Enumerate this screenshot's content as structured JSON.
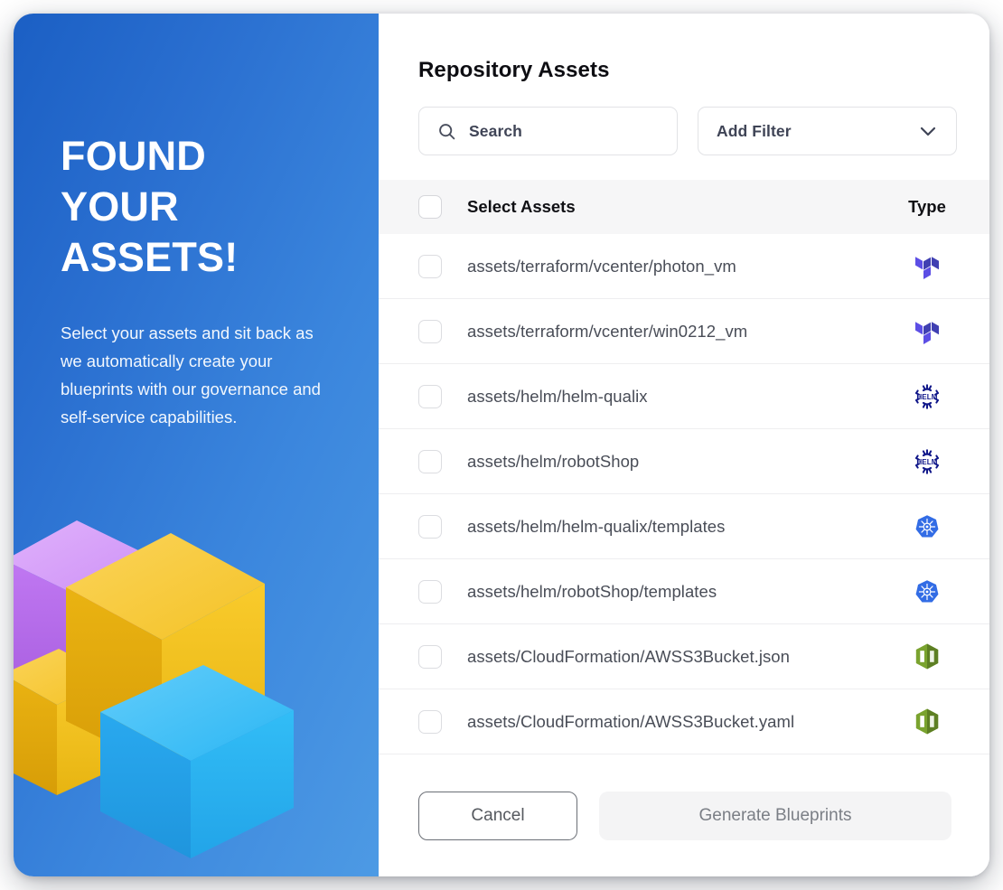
{
  "hero": {
    "title": "FOUND\nYOUR\nASSETS!",
    "subtitle": "Select your assets and sit back as we automatically create your blueprints with our governance and self-service capabilities.",
    "colors": {
      "gradient_start": "#1b5fc4",
      "gradient_end": "#4d9ae4",
      "box_purple": "#c77bf5",
      "box_yellow": "#f5c22b",
      "box_cyan": "#29b6f5"
    }
  },
  "panel": {
    "title": "Repository Assets"
  },
  "toolbar": {
    "search": {
      "value": "",
      "placeholder": "Search",
      "icon": "search-icon"
    },
    "filter": {
      "label": "Add Filter",
      "icon": "chevron-down-icon"
    }
  },
  "table": {
    "columns": {
      "select": "Select Assets",
      "type": "Type"
    },
    "header_checked": false,
    "rows": [
      {
        "name": "assets/terraform/vcenter/photon_vm",
        "type": "terraform",
        "type_icon": "terraform-icon",
        "checked": false
      },
      {
        "name": "assets/terraform/vcenter/win0212_vm",
        "type": "terraform",
        "type_icon": "terraform-icon",
        "checked": false
      },
      {
        "name": "assets/helm/helm-qualix",
        "type": "helm",
        "type_icon": "helm-icon",
        "checked": false
      },
      {
        "name": "assets/helm/robotShop",
        "type": "helm",
        "type_icon": "helm-icon",
        "checked": false
      },
      {
        "name": "assets/helm/helm-qualix/templates",
        "type": "kubernetes",
        "type_icon": "kubernetes-icon",
        "checked": false
      },
      {
        "name": "assets/helm/robotShop/templates",
        "type": "kubernetes",
        "type_icon": "kubernetes-icon",
        "checked": false
      },
      {
        "name": "assets/CloudFormation/AWSS3Bucket.json",
        "type": "cloudformation",
        "type_icon": "cloudformation-icon",
        "checked": false
      },
      {
        "name": "assets/CloudFormation/AWSS3Bucket.yaml",
        "type": "cloudformation",
        "type_icon": "cloudformation-icon",
        "checked": false
      }
    ]
  },
  "footer": {
    "cancel_label": "Cancel",
    "generate_label": "Generate Blueprints",
    "generate_disabled": true
  },
  "icon_colors": {
    "terraform": "#5c4ee5",
    "terraform_dark": "#4040b2",
    "helm": "#0f1689",
    "kubernetes": "#326ce5",
    "cloudformation": "#6b8f2f",
    "cloudformation_dark": "#4f6b22"
  }
}
